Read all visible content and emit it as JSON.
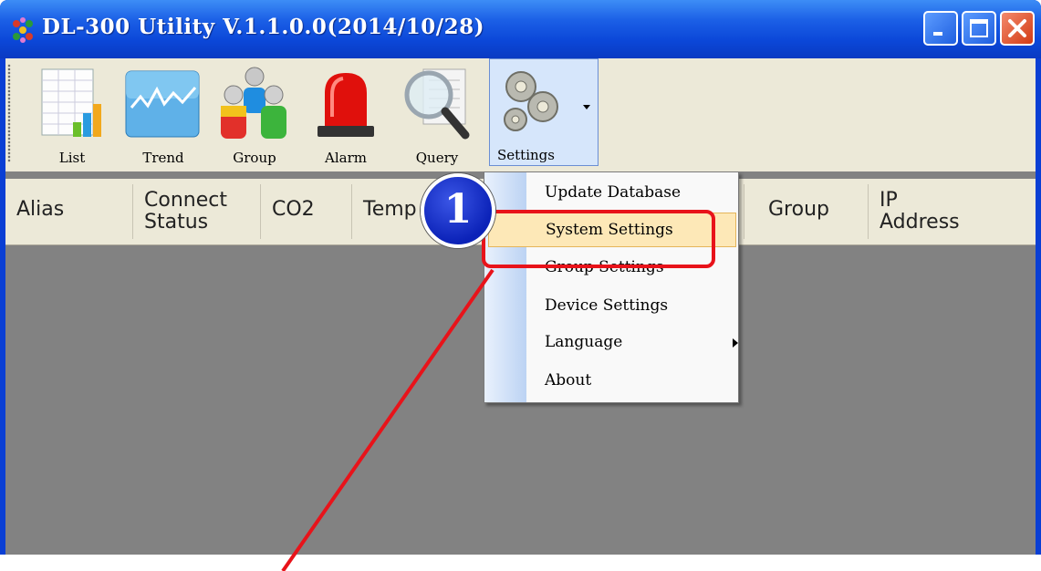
{
  "window": {
    "title": "DL-300 Utility V.1.1.0.0(2014/10/28)",
    "controls": [
      "minimize",
      "maximize",
      "close"
    ]
  },
  "toolbar": {
    "items": [
      {
        "label": "List",
        "icon": "list-chart-icon"
      },
      {
        "label": "Trend",
        "icon": "trend-chart-icon"
      },
      {
        "label": "Group",
        "icon": "group-people-icon"
      },
      {
        "label": "Alarm",
        "icon": "alarm-siren-icon"
      },
      {
        "label": "Query",
        "icon": "magnifier-icon"
      },
      {
        "label": "Settings",
        "icon": "gears-icon"
      }
    ]
  },
  "table": {
    "columns": [
      {
        "line1": "Alias",
        "line2": ""
      },
      {
        "line1": "Connect",
        "line2": "Status"
      },
      {
        "line1": "CO2",
        "line2": ""
      },
      {
        "line1": "Temp",
        "line2": ""
      },
      {
        "line1": "Group",
        "line2": ""
      },
      {
        "line1": "IP",
        "line2": "Address"
      }
    ]
  },
  "settings_menu": {
    "items": [
      {
        "label": "Update Database"
      },
      {
        "label": "System Settings",
        "highlighted": true
      },
      {
        "label": "Group Settings"
      },
      {
        "label": "Device Settings"
      },
      {
        "label": "Language",
        "has_submenu": true
      },
      {
        "label": "About"
      }
    ]
  },
  "annotation": {
    "step_number": "1",
    "color": "#e8131a",
    "callout_color": "#1a33d1"
  }
}
